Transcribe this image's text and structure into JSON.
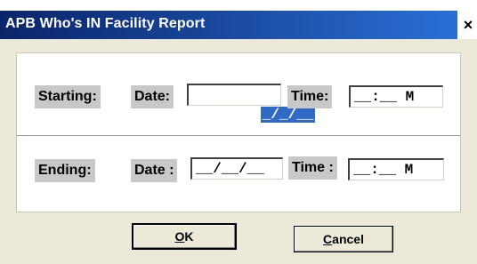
{
  "window": {
    "title": "APB Who's IN Facility Report",
    "close_glyph": "×"
  },
  "starting": {
    "label": "Starting:",
    "date_label": "Date:",
    "date_value": "_/_/__",
    "time_label": "Time:",
    "time_value": "__:__ M"
  },
  "ending": {
    "label": "Ending:",
    "date_label": "Date :",
    "date_value": "__/__/__",
    "time_label": "Time :",
    "time_value": "__:__ M"
  },
  "buttons": {
    "ok_mnemonic": "O",
    "ok_rest": "K",
    "cancel_mnemonic": "C",
    "cancel_rest": "ancel"
  },
  "colors": {
    "titlebar": "#0a246a",
    "selection": "#316ac5",
    "dialog_bg": "#ece9d8",
    "label_bg": "#c8c8c8"
  }
}
